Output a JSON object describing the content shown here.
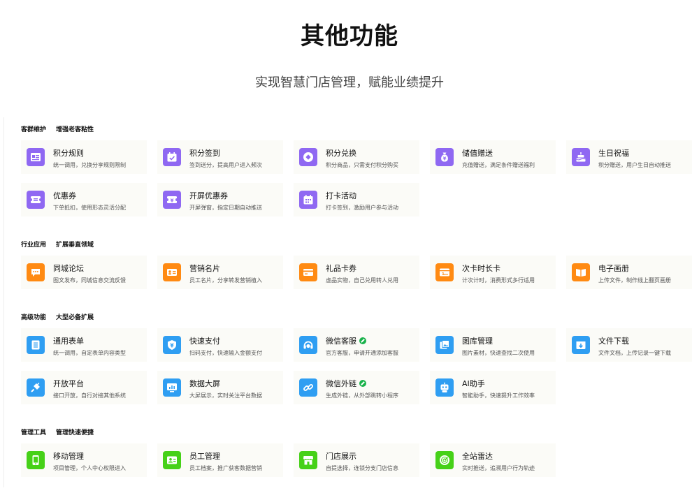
{
  "header": {
    "title": "其他功能",
    "subtitle": "实现智慧门店管理，赋能业绩提升"
  },
  "colors": {
    "purple": "#8f68f2",
    "orange": "#ff8a12",
    "blue": "#2f9ef2",
    "green": "#46d118",
    "card_bg": "#fbfbf7"
  },
  "sections": [
    {
      "label": "客群维护",
      "sublabel": "增强老客粘性",
      "items": [
        {
          "title": "积分规则",
          "desc": "统一调用，兑换分享规则限制",
          "icon": "rules-card-icon",
          "color": "purple"
        },
        {
          "title": "积分签到",
          "desc": "签到送分，提高用户进入频次",
          "icon": "checkin-calendar-icon",
          "color": "purple"
        },
        {
          "title": "积分兑换",
          "desc": "积分商品，只需支付积分购买",
          "icon": "diamond-exchange-icon",
          "color": "purple"
        },
        {
          "title": "储值赠送",
          "desc": "充值赠送，满足条件赠送福利",
          "icon": "money-bag-icon",
          "color": "purple"
        },
        {
          "title": "生日祝福",
          "desc": "积分赠送，用户生日自动推送",
          "icon": "birthday-cake-icon",
          "color": "purple"
        },
        {
          "title": "优惠券",
          "desc": "下单抵扣，使用形态灵活分配",
          "icon": "coupon-icon",
          "color": "purple"
        },
        {
          "title": "开屏优惠券",
          "desc": "开屏弹窗，指定日期自动推送",
          "icon": "splash-coupon-icon",
          "color": "purple"
        },
        {
          "title": "打卡活动",
          "desc": "打卡签到，激励用户参与活动",
          "icon": "clock-in-calendar-icon",
          "color": "purple"
        }
      ]
    },
    {
      "label": "行业应用",
      "sublabel": "扩展垂直领域",
      "items": [
        {
          "title": "同城论坛",
          "desc": "图文发布，同城信息交流反馈",
          "icon": "chat-bubble-icon",
          "color": "orange"
        },
        {
          "title": "营销名片",
          "desc": "员工名片，分享转发营销植入",
          "icon": "business-card-icon",
          "color": "orange"
        },
        {
          "title": "礼品卡券",
          "desc": "虚品实物，自己兑用转人兑用",
          "icon": "gift-card-icon",
          "color": "orange"
        },
        {
          "title": "次卡时长卡",
          "desc": "计次计时，消费形式多行适用",
          "icon": "time-card-icon",
          "color": "orange"
        },
        {
          "title": "电子画册",
          "desc": "上传文件，制作线上翻页画册",
          "icon": "open-book-icon",
          "color": "orange"
        }
      ]
    },
    {
      "label": "高级功能",
      "sublabel": "大型必备扩展",
      "items": [
        {
          "title": "通用表单",
          "desc": "统一调用，自定表单内容类型",
          "icon": "form-list-icon",
          "color": "blue",
          "link": false
        },
        {
          "title": "快速支付",
          "desc": "扫码支付，快速输入金额支付",
          "icon": "yen-shield-icon",
          "color": "blue",
          "link": false
        },
        {
          "title": "微信客服",
          "desc": "官方客服，申请开通添加客服",
          "icon": "headset-icon",
          "color": "blue",
          "link": true
        },
        {
          "title": "图库管理",
          "desc": "图片素材，快速查找二次使用",
          "icon": "image-library-icon",
          "color": "blue",
          "link": false
        },
        {
          "title": "文件下载",
          "desc": "文件文档，上传记录一键下载",
          "icon": "download-box-icon",
          "color": "blue",
          "link": false
        },
        {
          "title": "开放平台",
          "desc": "接口开放，自行对接其他系统",
          "icon": "plug-icon",
          "color": "blue",
          "link": false
        },
        {
          "title": "数据大屏",
          "desc": "大屏展示，实时关注平台数据",
          "icon": "data-screen-icon",
          "color": "blue",
          "link": false
        },
        {
          "title": "微信外链",
          "desc": "生成外链，从外部跳转小程序",
          "icon": "chain-link-icon",
          "color": "blue",
          "link": true
        },
        {
          "title": "AI助手",
          "desc": "智能助手，快速提升工作效率",
          "icon": "robot-icon",
          "color": "blue",
          "link": false
        }
      ]
    },
    {
      "label": "管理工具",
      "sublabel": "管理快速便捷",
      "items": [
        {
          "title": "移动管理",
          "desc": "项目管理，个人中心权限进入",
          "icon": "mobile-phone-icon",
          "color": "green"
        },
        {
          "title": "员工管理",
          "desc": "员工档案，推广获客数据营销",
          "icon": "staff-badge-icon",
          "color": "green"
        },
        {
          "title": "门店展示",
          "desc": "自提选择，连锁分支门店信息",
          "icon": "storefront-icon",
          "color": "green"
        },
        {
          "title": "全站雷达",
          "desc": "实时推送，追溯用户行为轨迹",
          "icon": "radar-icon",
          "color": "green"
        }
      ]
    }
  ]
}
